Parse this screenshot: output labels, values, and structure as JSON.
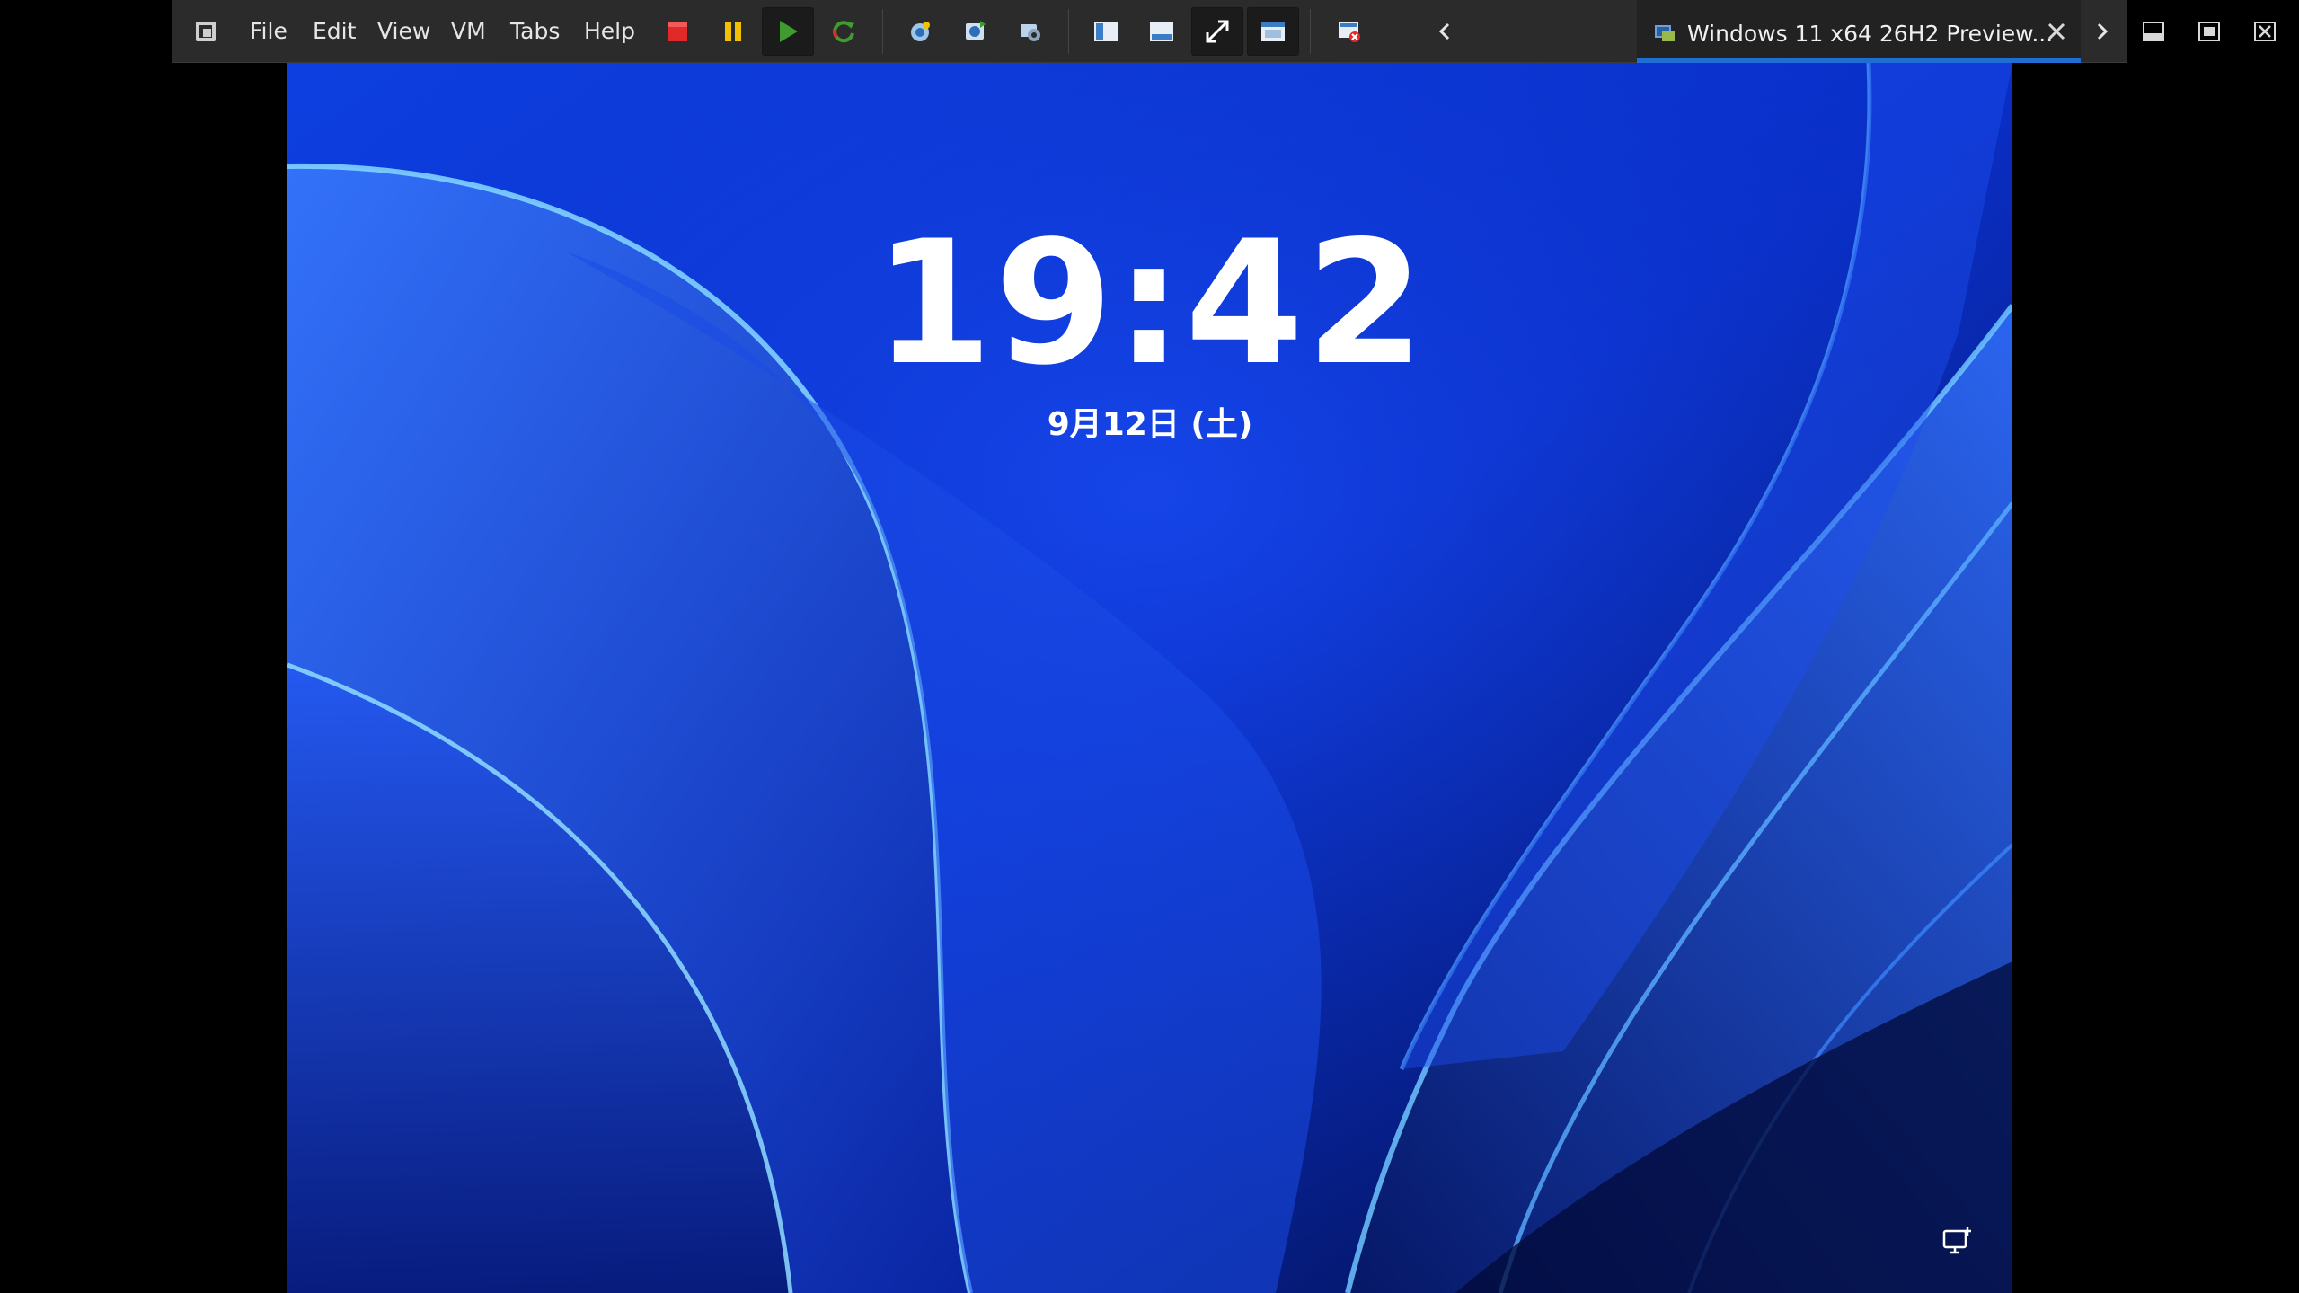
{
  "menu": {
    "file": "File",
    "edit": "Edit",
    "view": "View",
    "vm": "VM",
    "tabs": "Tabs",
    "help": "Help"
  },
  "toolbar_icons": [
    "app-icon",
    "power-off-icon",
    "suspend-icon",
    "power-on-icon",
    "reset-icon",
    "snapshot-icon",
    "revert-snapshot-icon",
    "snapshot-manager-icon",
    "console-view-icon",
    "thumbnail-view-icon",
    "full-screen-icon",
    "unity-icon",
    "close-console-icon"
  ],
  "tab": {
    "title": "Windows 11 x64 26H2 Preview..."
  },
  "lock_screen": {
    "time": "19:42",
    "date": "9月12日 (土)"
  },
  "colors": {
    "toolbar_bg": "#2b2b2b",
    "tab_accent": "#1f6ed4",
    "wallpaper_base": "#0a33d6",
    "stop_red": "#e02a2a",
    "pause_yellow": "#f2c200",
    "play_green": "#3f9a2f"
  }
}
